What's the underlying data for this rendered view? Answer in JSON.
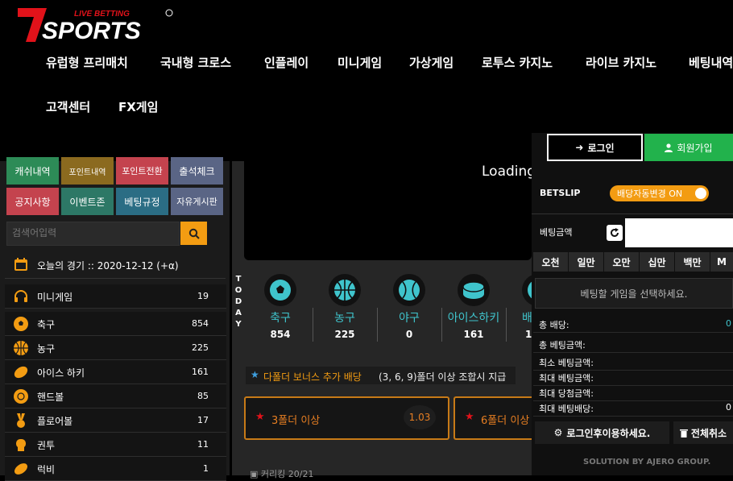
{
  "brand": {
    "name": "7SPORTS",
    "tagline": "LIVE BETTING"
  },
  "nav": {
    "items": [
      "유럽형 프리매치",
      "국내형 크로스",
      "인플레이",
      "미니게임",
      "가상게임",
      "로투스 카지노",
      "라이브 카지노",
      "베팅내역",
      "고객센터",
      "FX게임"
    ]
  },
  "quick_buttons": [
    {
      "label": "캐쉬내역",
      "color": "#2d8b57"
    },
    {
      "label": "포인트내역",
      "color": "#8b6a1f"
    },
    {
      "label": "포인트전환",
      "color": "#c4434e"
    },
    {
      "label": "출석체크",
      "color": "#5a6585"
    },
    {
      "label": "공지사항",
      "color": "#c4434e"
    },
    {
      "label": "이벤트존",
      "color": "#2d7866"
    },
    {
      "label": "베팅규정",
      "color": "#2b6d84"
    },
    {
      "label": "자유게시판",
      "color": "#5a6585"
    }
  ],
  "search": {
    "placeholder": "검색어입력"
  },
  "today": {
    "label": "오늘의 경기 :: 2020-12-12 (+α)"
  },
  "sports_list": [
    {
      "name": "미니게임",
      "count": "19",
      "icon": "headset-icon"
    },
    {
      "name": "축구",
      "count": "854",
      "icon": "soccer-icon"
    },
    {
      "name": "농구",
      "count": "225",
      "icon": "basketball-icon"
    },
    {
      "name": "아이스 하키",
      "count": "161",
      "icon": "hockey-icon"
    },
    {
      "name": "핸드볼",
      "count": "85",
      "icon": "handball-icon"
    },
    {
      "name": "플로어볼",
      "count": "17",
      "icon": "medal-icon"
    },
    {
      "name": "권투",
      "count": "11",
      "icon": "boxing-icon"
    },
    {
      "name": "럭비",
      "count": "1",
      "icon": "rugby-icon"
    }
  ],
  "video": {
    "loading": "Loading"
  },
  "today_strip": "TODAY",
  "sports_strip": [
    {
      "name": "축구",
      "count": "854"
    },
    {
      "name": "농구",
      "count": "225"
    },
    {
      "name": "야구",
      "count": "0"
    },
    {
      "name": "아이스하키",
      "count": "161"
    },
    {
      "name": "배",
      "count": "1"
    }
  ],
  "bonus": {
    "text": "다폴더 보너스 추가 배당",
    "rule": "(3, 6, 9)폴더 이상 조합시 지급"
  },
  "bonus_cards": [
    {
      "label": "3폴더 이상",
      "odds": "1.03"
    },
    {
      "label": "6폴더 이상",
      "odds": ""
    }
  ],
  "bottom_text": "커리킹 20/21",
  "auth": {
    "login": "로그인",
    "join": "회원가입"
  },
  "betslip": {
    "title": "BETSLIP",
    "auto_change": "배당자동변경 ON",
    "bet_amount_label": "베팅금액",
    "amounts": [
      "오천",
      "일만",
      "오만",
      "십만",
      "백만",
      "M"
    ],
    "select_msg": "베팅할 게임을 선택하세요.",
    "summary": [
      {
        "label": "총 배당:",
        "value": "0"
      },
      {
        "label": "총 베팅금액:",
        "value": ""
      },
      {
        "label": "최소 베팅금액:",
        "value": ""
      },
      {
        "label": "최대 베팅금액:",
        "value": ""
      },
      {
        "label": "최대 당첨금액:",
        "value": ""
      },
      {
        "label": "최대 베팅배당:",
        "value": "0"
      }
    ],
    "login_use": "로그인후이용하세요.",
    "cancel_all": "전체취소"
  },
  "footer": {
    "solution": "SOLUTION BY AJERO GROUP."
  },
  "colors": {
    "accent": "#f39c12",
    "teal": "#3fc4cc",
    "green": "#22b24c",
    "bonus_border": "#c77a17"
  }
}
